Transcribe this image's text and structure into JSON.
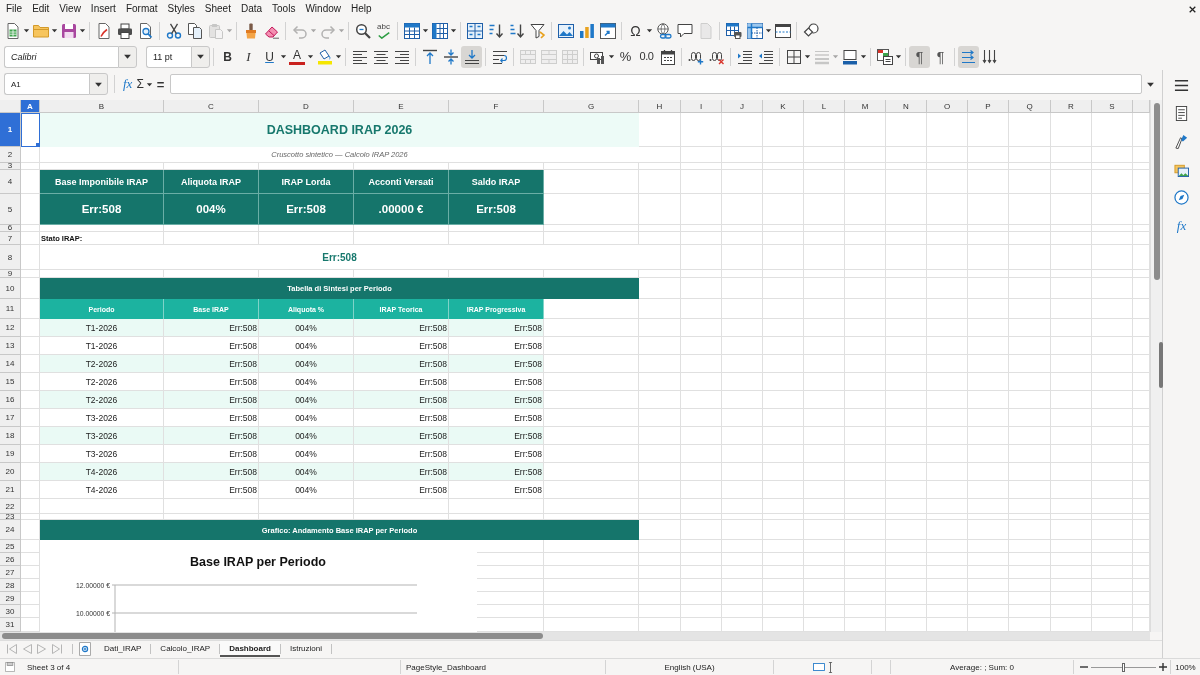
{
  "menu_bar": {
    "items": [
      "File",
      "Edit",
      "View",
      "Insert",
      "Format",
      "Styles",
      "Sheet",
      "Data",
      "Tools",
      "Window",
      "Help"
    ]
  },
  "standard_toolbar": {
    "paste": {
      "disabled": true
    },
    "undo": {
      "disabled": true
    },
    "redo": {
      "disabled": true
    },
    "spelling": {
      "glyph": "abc"
    },
    "special_character": {
      "glyph": "Ω"
    },
    "header_footer": {
      "disabled": true
    }
  },
  "formatting_toolbar": {
    "font_name": "Calibri",
    "font_size": "11 pt",
    "bold": {
      "glyph": "B"
    },
    "italic": {
      "glyph": "I"
    },
    "underline": {
      "glyph": "U"
    },
    "font_color": {
      "glyph": "A"
    },
    "align_left": {
      "selected": false
    },
    "align_center": {
      "selected": false
    },
    "align_right": {
      "selected": false
    },
    "align_top": {
      "selected": false
    },
    "align_middle": {
      "selected": false
    },
    "align_bottom": {
      "selected": true
    },
    "merge_center": {
      "disabled": true
    },
    "merge": {
      "disabled": true
    },
    "unmerge": {
      "disabled": true
    },
    "percent": {
      "glyph": "%"
    },
    "standard_format": {
      "glyph": "0.0"
    },
    "border_style": {
      "disabled": true
    },
    "left_to_right": {
      "glyph": "¶",
      "selected": true
    },
    "right_to_left": {
      "glyph": "¶",
      "selected": false
    },
    "text_left_to_right": {
      "selected": true
    },
    "text_top_to_bottom": {
      "selected": false
    }
  },
  "formula_bar": {
    "cell_reference": "A1",
    "function_wizard": "fx",
    "sum": "Σ",
    "equals": "="
  },
  "sheet": {
    "column_headers": [
      {
        "label": "A",
        "selected": true
      },
      {
        "label": "B",
        "selected": false
      },
      {
        "label": "C",
        "selected": false
      },
      {
        "label": "D",
        "selected": false
      },
      {
        "label": "E",
        "selected": false
      },
      {
        "label": "F",
        "selected": false
      },
      {
        "label": "G",
        "selected": false
      },
      {
        "label": "H",
        "selected": false
      },
      {
        "label": "I",
        "selected": false
      },
      {
        "label": "J",
        "selected": false
      },
      {
        "label": "K",
        "selected": false
      },
      {
        "label": "L",
        "selected": false
      },
      {
        "label": "M",
        "selected": false
      },
      {
        "label": "N",
        "selected": false
      },
      {
        "label": "O",
        "selected": false
      },
      {
        "label": "P",
        "selected": false
      },
      {
        "label": "Q",
        "selected": false
      },
      {
        "label": "R",
        "selected": false
      },
      {
        "label": "S",
        "selected": false
      }
    ],
    "row_headers": [
      {
        "label": "1",
        "selected": true
      },
      {
        "label": "2",
        "selected": false
      },
      {
        "label": "3",
        "selected": false
      },
      {
        "label": "4",
        "selected": false
      },
      {
        "label": "5",
        "selected": false
      },
      {
        "label": "6",
        "selected": false
      },
      {
        "label": "7",
        "selected": false
      },
      {
        "label": "8",
        "selected": false
      },
      {
        "label": "9",
        "selected": false
      },
      {
        "label": "10",
        "selected": false
      },
      {
        "label": "11",
        "selected": false
      },
      {
        "label": "12",
        "selected": false
      },
      {
        "label": "13",
        "selected": false
      },
      {
        "label": "14",
        "selected": false
      },
      {
        "label": "15",
        "selected": false
      },
      {
        "label": "16",
        "selected": false
      },
      {
        "label": "17",
        "selected": false
      },
      {
        "label": "18",
        "selected": false
      },
      {
        "label": "19",
        "selected": false
      },
      {
        "label": "20",
        "selected": false
      },
      {
        "label": "21",
        "selected": false
      },
      {
        "label": "22",
        "selected": false
      },
      {
        "label": "23",
        "selected": false
      },
      {
        "label": "24",
        "selected": false
      },
      {
        "label": "25",
        "selected": false
      },
      {
        "label": "26",
        "selected": false
      },
      {
        "label": "27",
        "selected": false
      },
      {
        "label": "28",
        "selected": false
      },
      {
        "label": "29",
        "selected": false
      },
      {
        "label": "30",
        "selected": false
      },
      {
        "label": "31",
        "selected": false
      }
    ],
    "dashboard": {
      "title": "DASHBOARD IRAP 2026",
      "subtitle": "Cruscotto sintetico — Calcolo IRAP 2026",
      "kpis": [
        {
          "label": "Base Imponibile IRAP",
          "value": "Err:508"
        },
        {
          "label": "Aliquota IRAP",
          "value": "004%"
        },
        {
          "label": "IRAP Lorda",
          "value": "Err:508"
        },
        {
          "label": "Acconti Versati",
          "value": ".00000 €"
        },
        {
          "label": "Saldo IRAP",
          "value": "Err:508"
        }
      ],
      "status_label": "Stato IRAP:",
      "status_value": "Err:508",
      "summary_table": {
        "title": "Tabella di Sintesi per Periodo",
        "columns": [
          "Periodo",
          "Base IRAP",
          "Aliquota %",
          "IRAP Teorica",
          "IRAP Progressiva"
        ],
        "rows": [
          [
            "T1-2026",
            "Err:508",
            "004%",
            "Err:508",
            "Err:508"
          ],
          [
            "T1-2026",
            "Err:508",
            "004%",
            "Err:508",
            "Err:508"
          ],
          [
            "T2-2026",
            "Err:508",
            "004%",
            "Err:508",
            "Err:508"
          ],
          [
            "T2-2026",
            "Err:508",
            "004%",
            "Err:508",
            "Err:508"
          ],
          [
            "T2-2026",
            "Err:508",
            "004%",
            "Err:508",
            "Err:508"
          ],
          [
            "T3-2026",
            "Err:508",
            "004%",
            "Err:508",
            "Err:508"
          ],
          [
            "T3-2026",
            "Err:508",
            "004%",
            "Err:508",
            "Err:508"
          ],
          [
            "T3-2026",
            "Err:508",
            "004%",
            "Err:508",
            "Err:508"
          ],
          [
            "T4-2026",
            "Err:508",
            "004%",
            "Err:508",
            "Err:508"
          ],
          [
            "T4-2026",
            "Err:508",
            "004%",
            "Err:508",
            "Err:508"
          ]
        ]
      },
      "chart_section": {
        "title": "Grafico: Andamento Base IRAP per Periodo",
        "chart": {
          "title": "Base IRAP per Periodo",
          "y_axis_labels": [
            "12.00000 €",
            "10.00000 €"
          ]
        }
      }
    }
  },
  "sheet_tabs": [
    {
      "label": "Dati_IRAP",
      "selected": false
    },
    {
      "label": "Calcolo_IRAP",
      "selected": false
    },
    {
      "label": "Dashboard",
      "selected": true
    },
    {
      "label": "Istruzioni",
      "selected": false
    }
  ],
  "sidebar": {
    "functions_tab": "fx"
  },
  "status_bar": {
    "sheet_position": "Sheet 3 of 4",
    "page_style": "PageStyle_Dashboard",
    "language": "English (USA)",
    "selection_summary": "Average: ; Sum: 0",
    "zoom": {
      "level": 0.5,
      "reading": "100%"
    }
  }
}
